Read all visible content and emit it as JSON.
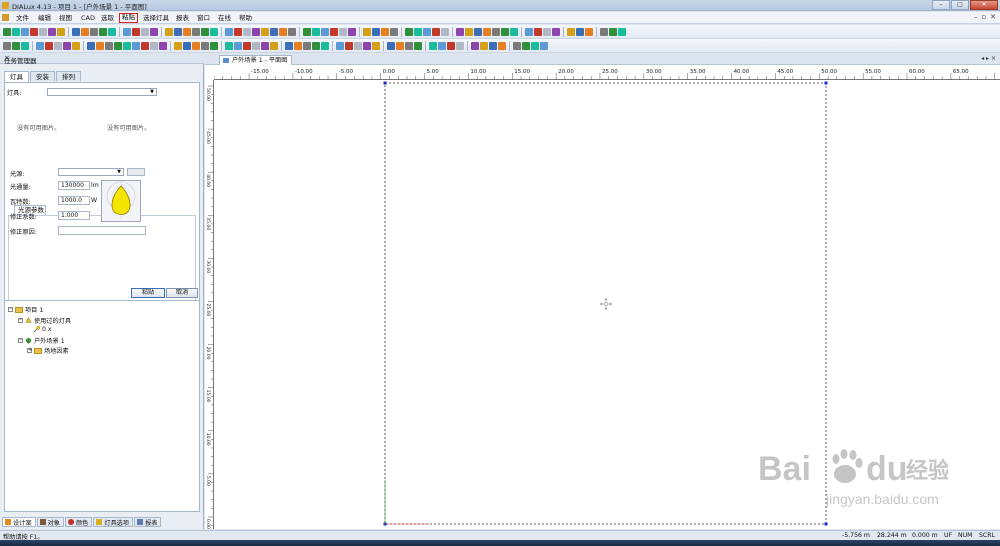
{
  "window": {
    "title": "DIALux 4.13 - 项目 1 - [户外场景 1 - 平面图]",
    "btn_min": "–",
    "btn_max": "□",
    "btn_close": "✕"
  },
  "menu": {
    "items": [
      "文件",
      "编辑",
      "视图",
      "CAD",
      "选取",
      "粘贴",
      "选择灯具",
      "报表",
      "窗口",
      "在线",
      "帮助"
    ],
    "highlighted": "粘贴",
    "highlight_color": "#e02020",
    "mdi_min": "–",
    "mdi_restore": "▫",
    "mdi_close": "✕"
  },
  "task_manager": {
    "title": "任务管理器",
    "pin": "×",
    "tabs": [
      "灯具",
      "安装",
      "排列"
    ],
    "active_tab": "灯具",
    "luminaire_label": "灯具:",
    "luminaire_value": "",
    "no_data_1": "没有可用图片。",
    "no_data_2": "没有可用图片。",
    "lamp_tab_label": "光源参数",
    "lamp_tab_index": "1",
    "lamp_source_label": "光源:",
    "lamp_source_value": "",
    "flux_label": "光通量:",
    "flux_value": "130000",
    "flux_unit": "lm",
    "watt_label": "瓦特数:",
    "watt_value": "1000.0",
    "watt_unit": "W",
    "correction_label": "修正系数:",
    "correction_value": "1.000",
    "reason_label": "修正原因:",
    "reason_value": "",
    "paste_button": "粘贴",
    "cancel_button": "取消"
  },
  "tree": {
    "root": "项目 1",
    "used_luminaires": "使用过的灯具",
    "used_count": "0 x",
    "scene": "户外场景 1",
    "site_elements": "场地因素"
  },
  "bottom_tabs": [
    "设计案",
    "对象",
    "颜色",
    "灯具选项",
    "报表"
  ],
  "doc": {
    "tab_title": "户外场景 1 - 平面图",
    "nav": "◂ ▸ ×",
    "h_ticks": [
      "-15.00",
      "-10.00",
      "-5.00",
      "0.00",
      "5.00",
      "10.00",
      "15.00",
      "20.00",
      "25.00",
      "30.00",
      "35.00",
      "40.00",
      "45.00",
      "50.00",
      "55.00",
      "60.00",
      "65.00"
    ],
    "v_ticks": [
      "50.00",
      "45.00",
      "40.00",
      "35.00",
      "30.00",
      "25.00",
      "20.00",
      "15.00",
      "10.00",
      "5.00",
      "0.00"
    ],
    "h_range_m": [
      -19,
      70.6
    ],
    "v_range_m": [
      50.7,
      -1.4
    ],
    "scene_extent_m": {
      "x": [
        0,
        50
      ],
      "y": [
        0,
        50
      ]
    }
  },
  "status": {
    "help": "帮助请按 F1。",
    "x_coord": "-5.756 m",
    "y_coord": "28.244 m",
    "z_coord": "0.000 m",
    "uf": "UF",
    "num": "NUM",
    "scrl": "SCRL"
  },
  "watermark": {
    "brand_left": "Bai",
    "brand_right": "du",
    "brand_cn": "经验",
    "url": "jingyan.baidu.com"
  }
}
